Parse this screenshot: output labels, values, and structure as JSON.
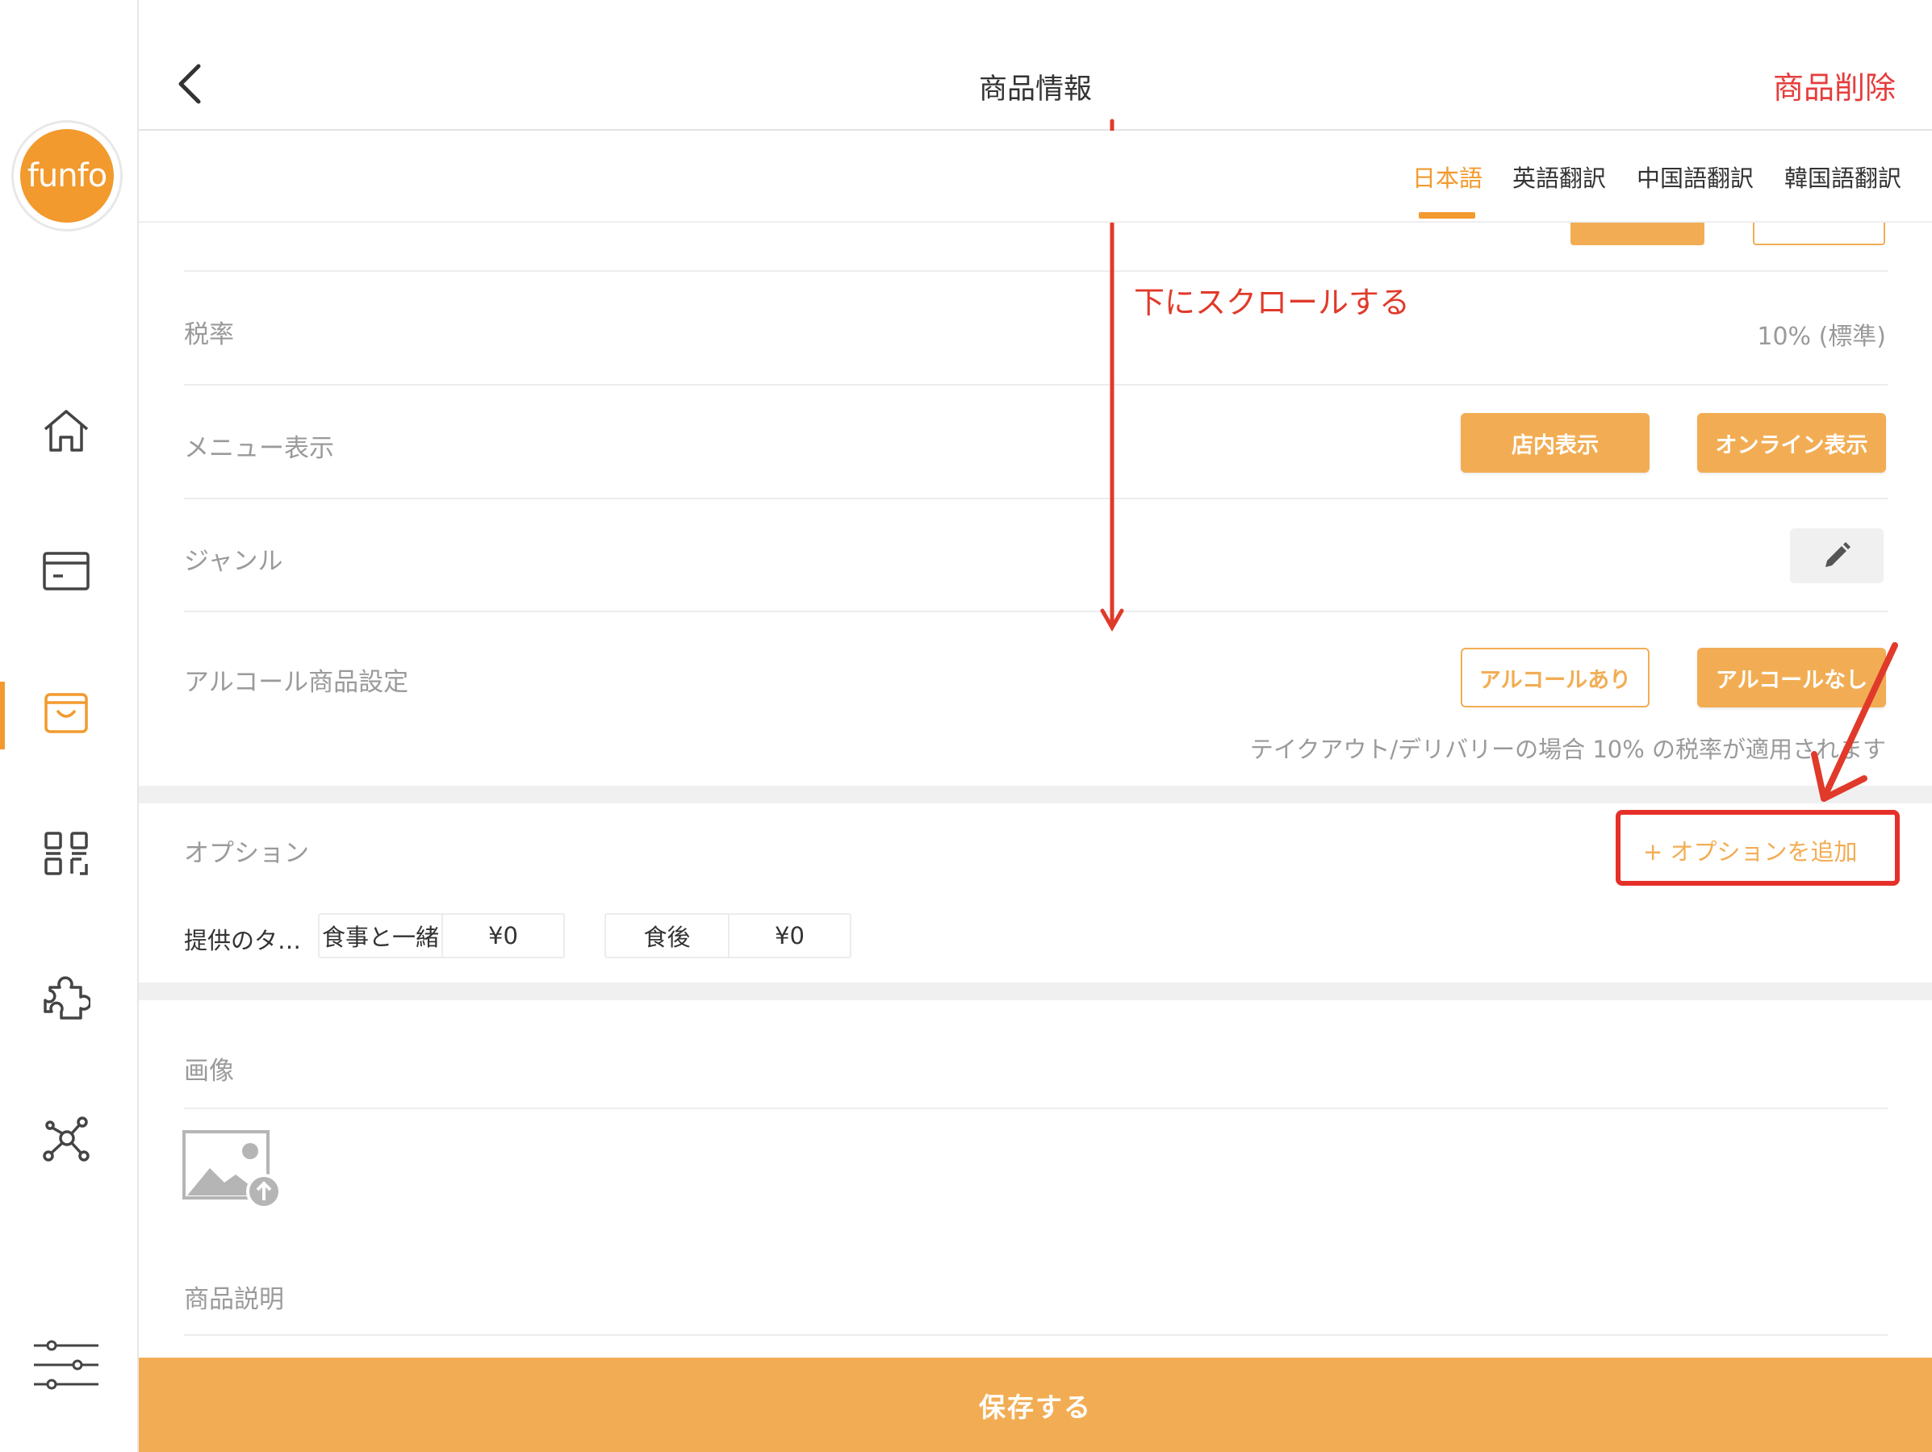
{
  "sidebar": {
    "logo_text": "funfo",
    "items": [
      {
        "icon": "home-icon"
      },
      {
        "icon": "register-icon"
      },
      {
        "icon": "shopping-bag-icon",
        "active": true
      },
      {
        "icon": "qr-code-icon"
      },
      {
        "icon": "puzzle-icon"
      },
      {
        "icon": "network-icon"
      },
      {
        "icon": "sliders-icon"
      }
    ],
    "accent_color": "#f29a2e"
  },
  "header": {
    "back_icon": "chevron-left-icon",
    "title": "商品情報",
    "delete_label": "商品削除"
  },
  "language_tabs": [
    {
      "label": "日本語",
      "active": true
    },
    {
      "label": "英語翻訳",
      "active": false
    },
    {
      "label": "中国語翻訳",
      "active": false
    },
    {
      "label": "韓国語翻訳",
      "active": false
    }
  ],
  "rows": {
    "tax": {
      "label": "税率",
      "value": "10% (標準)"
    },
    "menu_display": {
      "label": "メニュー表示",
      "store_button": "店内表示",
      "online_button": "オンライン表示"
    },
    "genre": {
      "label": "ジャンル",
      "edit_icon": "pencil-icon"
    },
    "alcohol": {
      "label": "アルコール商品設定",
      "with_alcohol": "アルコールあり",
      "without_alcohol": "アルコールなし",
      "note": "テイクアウト/デリバリーの場合 10% の税率が適用されます"
    }
  },
  "options": {
    "label": "オプション",
    "add_button": "+ オプションを追加",
    "group_title": "提供のタ…",
    "choices": [
      {
        "name": "食事と一緒",
        "price": "¥0"
      },
      {
        "name": "食後",
        "price": "¥0"
      }
    ]
  },
  "image_section": {
    "label": "画像",
    "icon": "image-upload-icon"
  },
  "description_section": {
    "label": "商品説明"
  },
  "save_button": "保存する",
  "annotation": {
    "scroll_text": "下にスクロールする",
    "color": "#e03a2a"
  },
  "colors": {
    "primary": "#f2ad54",
    "danger": "#e63d3d"
  }
}
